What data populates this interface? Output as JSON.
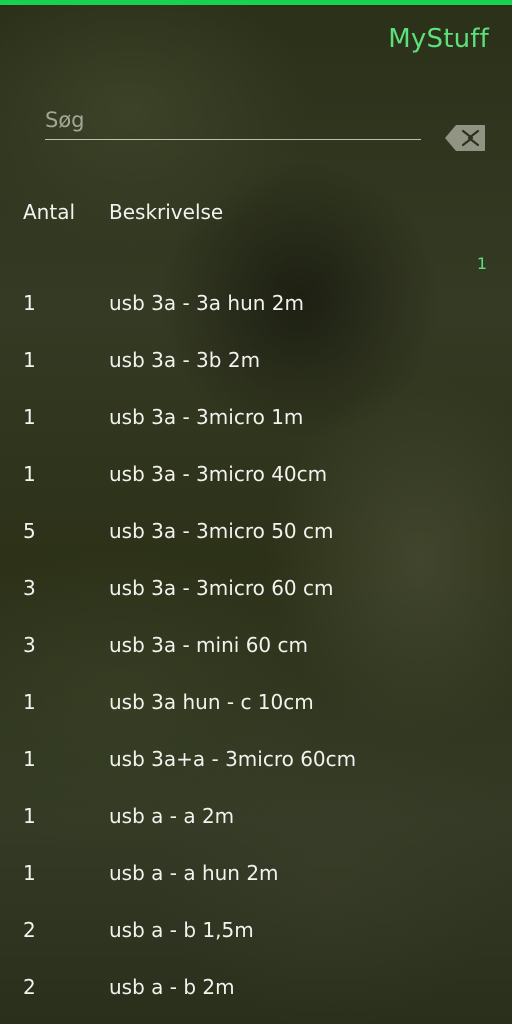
{
  "app": {
    "title": "MyStuff"
  },
  "search": {
    "placeholder": "Søg",
    "value": ""
  },
  "table": {
    "headers": {
      "quantity": "Antal",
      "description": "Beskrivelse"
    },
    "section_count": "1",
    "rows": [
      {
        "qty": "1",
        "desc": "usb 3a - 3a hun 2m"
      },
      {
        "qty": "1",
        "desc": "usb 3a - 3b 2m"
      },
      {
        "qty": "1",
        "desc": "usb 3a - 3micro 1m"
      },
      {
        "qty": "1",
        "desc": "usb 3a - 3micro 40cm"
      },
      {
        "qty": "5",
        "desc": "usb 3a - 3micro 50 cm"
      },
      {
        "qty": "3",
        "desc": "usb 3a - 3micro 60 cm"
      },
      {
        "qty": "3",
        "desc": "usb 3a - mini 60 cm"
      },
      {
        "qty": "1",
        "desc": "usb 3a hun - c 10cm"
      },
      {
        "qty": "1",
        "desc": "usb 3a+a - 3micro 60cm"
      },
      {
        "qty": "1",
        "desc": "usb a - a 2m"
      },
      {
        "qty": "1",
        "desc": "usb a - a hun 2m"
      },
      {
        "qty": "2",
        "desc": "usb a - b 1,5m"
      },
      {
        "qty": "2",
        "desc": "usb a - b 2m"
      }
    ]
  },
  "icons": {
    "clear": "backspace-clear-icon"
  },
  "colors": {
    "accent": "#19d150",
    "title": "#5de07c",
    "text": "#f2f2ee"
  }
}
